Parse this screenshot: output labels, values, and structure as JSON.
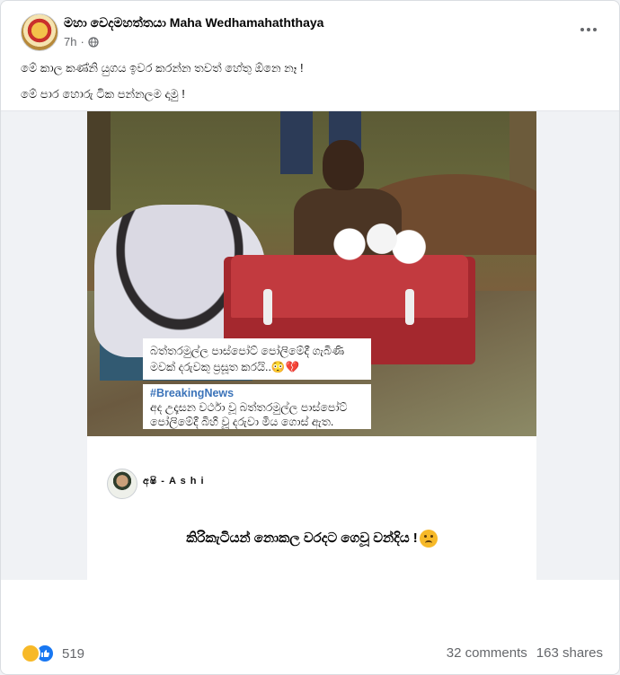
{
  "post": {
    "page_name": "මහා වෙදමහත්තයා Maha Wedhamahaththaya",
    "time": "7h",
    "dot": "·",
    "caption_lines": [
      "මේ කාල කණ්නි යුගය ඉවර කරන්න තවත් හේතු ඕනෙ නෑ !",
      "මේ පාර හොරු ටික පන්නලම දාමු !"
    ]
  },
  "media": {
    "caption_1": "බත්තරමුල්ල පාස්පෝට් පෝලිමේදී ගැබිණි මවක් දරුවකු ප්‍රසූත කරයි..😳💔",
    "caption_2_tag": "#BreakingNews",
    "caption_2": "අද උදෑසන වර්ථා වූ බත්තරමුල්ල පාස්පෝට් පෝලිමේදී බිහි වූ දරුවා මිය ගොස් ඇත.",
    "quote_author": "අෂි - A s h i",
    "quote_text": "කිරිකැටියන් නොකල වරදට ගෙවූ වන්දිය !"
  },
  "footer": {
    "reaction_count": "519",
    "comments": "32 comments",
    "shares": "163 shares"
  },
  "icons": {
    "globe": "globe-icon",
    "more": "more-options-icon",
    "sad": "sad-reaction-icon",
    "like": "like-reaction-icon"
  },
  "colors": {
    "link_blue": "#1877f2",
    "secondary_text": "#65676b",
    "tag_blue": "#3b73b9"
  }
}
